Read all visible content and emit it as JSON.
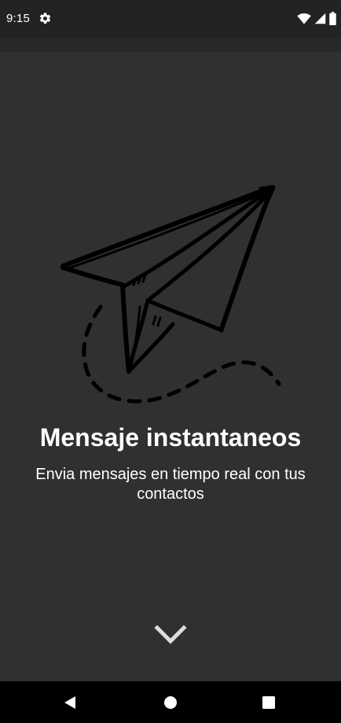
{
  "status_bar": {
    "time": "9:15",
    "settings_icon": "gear-icon",
    "wifi_icon": "wifi-icon",
    "signal_icon": "cellular-signal-icon",
    "battery_icon": "battery-icon"
  },
  "onboarding": {
    "illustration_icon": "paper-plane-icon",
    "title": "Mensaje instantaneos",
    "subtitle": "Envia mensajes en tiempo real con tus contactos",
    "next_icon": "chevron-down-icon"
  },
  "nav_bar": {
    "back_icon": "back-triangle-icon",
    "home_icon": "home-circle-icon",
    "recents_icon": "recents-square-icon"
  },
  "colors": {
    "background": "#303030",
    "status_bar": "#232323",
    "text": "#ffffff",
    "chevron": "#dddddd",
    "nav_bar": "#000000"
  }
}
